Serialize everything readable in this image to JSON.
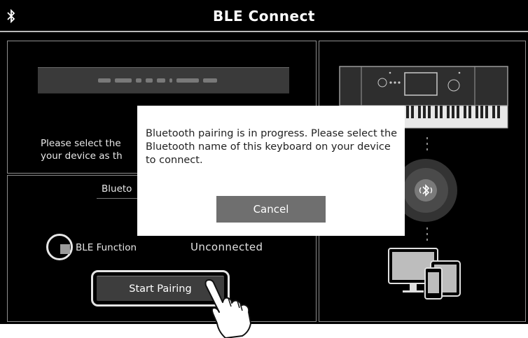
{
  "titlebar": {
    "title": "BLE Connect",
    "icon": "bluetooth-icon"
  },
  "left_panel": {
    "device_name_value": "",
    "instruction": [
      "Please select the",
      "your device as th"
    ],
    "section_label": "Blueto",
    "ble_function_label": "BLE Function",
    "ble_function_checked": false,
    "status": "Unconnected",
    "start_pairing_label": "Start Pairing"
  },
  "dialog": {
    "message": "Bluetooth pairing is in progress. Please select the Bluetooth name of this keyboard on your device to connect.",
    "cancel_label": "Cancel"
  },
  "right_panel": {
    "keyboard_illustration": "keyboard-illustration",
    "bluetooth_badge": "bluetooth-signal-icon",
    "devices_illustration": "devices-icon"
  },
  "colors": {
    "background": "#000000",
    "panel_border": "#8f8f8f",
    "dialog_bg": "#ffffff",
    "cancel_button": "#6f6f6f",
    "pair_button": "#3d3d3d"
  }
}
